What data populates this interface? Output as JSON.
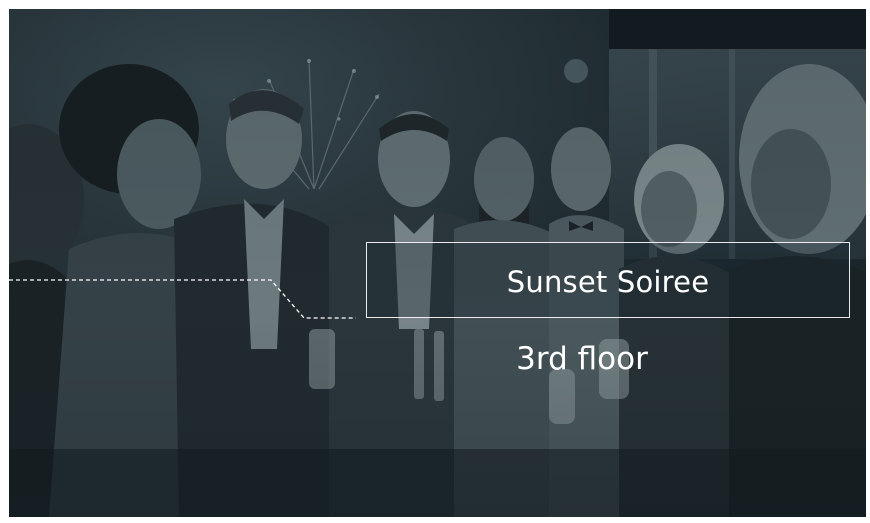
{
  "event": {
    "title": "Sunset Soiree",
    "location": "3rd floor"
  },
  "colors": {
    "overlay_tint": "#1f2b30",
    "text": "#ffffff",
    "outline": "#ffffff"
  },
  "icons": {
    "leader_line": "dashed-leader-line"
  }
}
